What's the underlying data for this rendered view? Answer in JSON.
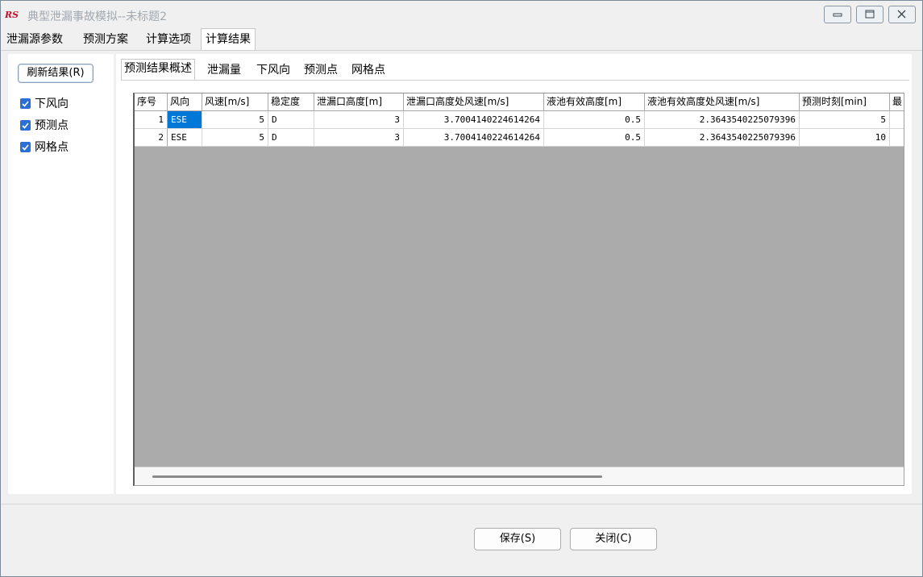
{
  "window": {
    "title": "典型泄漏事故模拟--未标题2",
    "logo_text": "RS"
  },
  "main_tabs": [
    "泄漏源参数",
    "预测方案",
    "计算选项",
    "计算结果"
  ],
  "left_panel": {
    "refresh_label": "刷新结果(R)",
    "checkboxes": [
      {
        "label": "下风向",
        "checked": true
      },
      {
        "label": "预测点",
        "checked": true
      },
      {
        "label": "网格点",
        "checked": true
      }
    ]
  },
  "sub_tabs": [
    "预测结果概述",
    "泄漏量",
    "下风向",
    "预测点",
    "网格点"
  ],
  "table": {
    "columns": [
      "序号",
      "风向",
      "风速[m/s]",
      "稳定度",
      "泄漏口高度[m]",
      "泄漏口高度处风速[m/s]",
      "液池有效高度[m]",
      "液池有效高度处风速[m/s]",
      "预测时刻[min]",
      "最"
    ],
    "rows": [
      [
        "1",
        "ESE",
        "5",
        "D",
        "3",
        "3.7004140224614264",
        "0.5",
        "2.3643540225079396",
        "5"
      ],
      [
        "2",
        "ESE",
        "5",
        "D",
        "3",
        "3.7004140224614264",
        "0.5",
        "2.3643540225079396",
        "10"
      ]
    ]
  },
  "footer": {
    "save_label": "保存(S)",
    "close_label": "关闭(C)"
  },
  "colors": {
    "selection": "#0078d7",
    "checkbox": "#2a6fd6",
    "grid_empty": "#ababab"
  }
}
